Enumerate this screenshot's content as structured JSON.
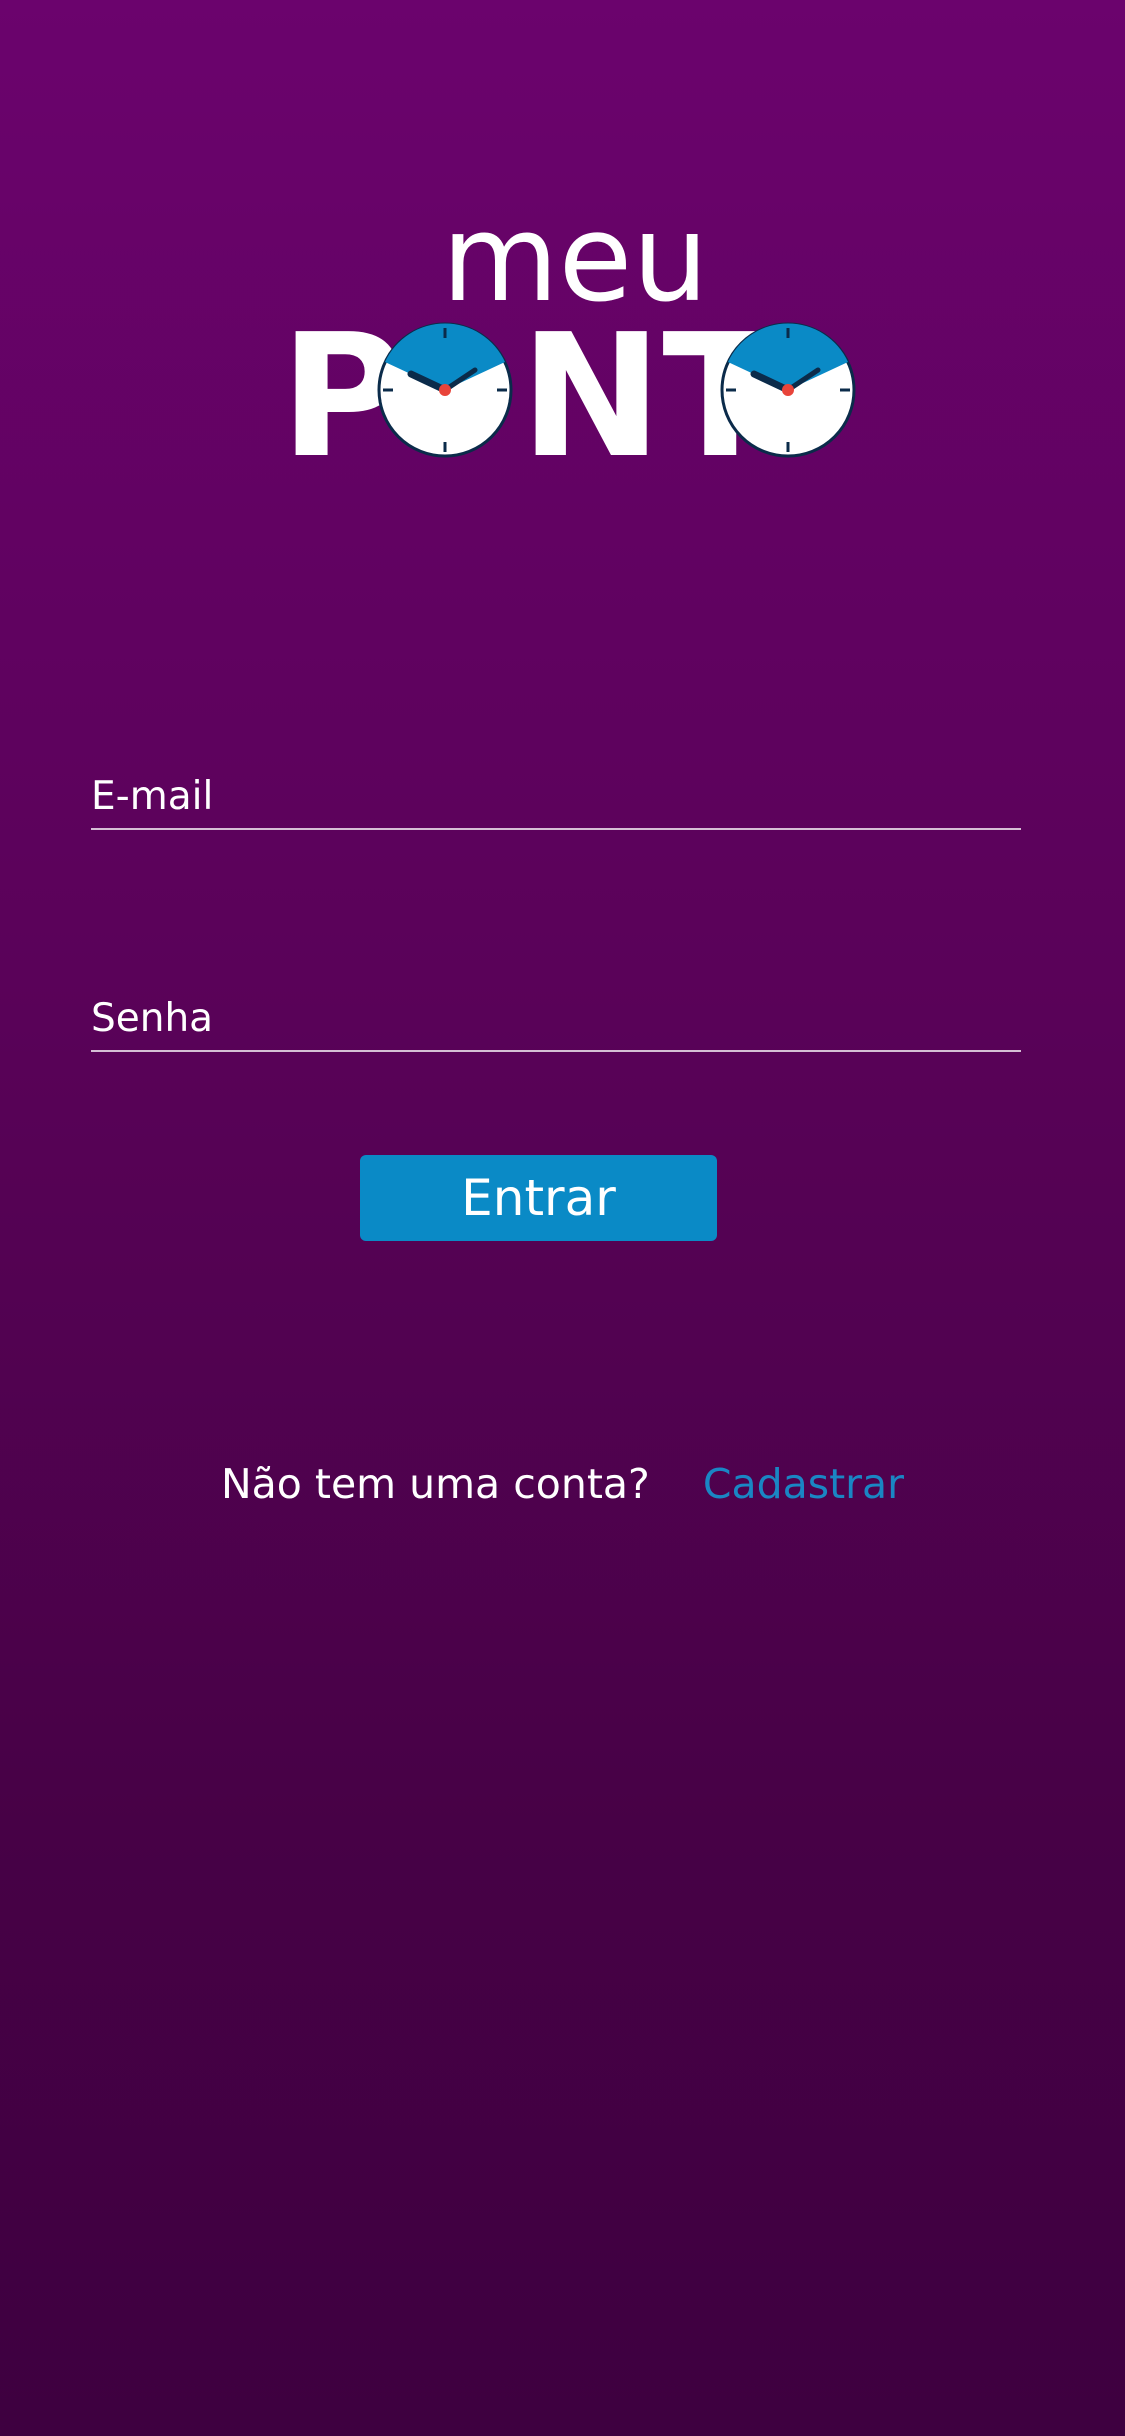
{
  "logo": {
    "line1": "meu",
    "line2_p": "P",
    "line2_nt": "NT",
    "clock_face_color": "#ffffff",
    "clock_accent_color": "#0a8ac6",
    "clock_hand_color": "#0b2b4a",
    "clock_center_color": "#e8443a"
  },
  "login": {
    "email_placeholder": "E-mail",
    "password_placeholder": "Senha",
    "submit_label": "Entrar"
  },
  "signup": {
    "question": "Não tem uma conta?",
    "link_label": "Cadastrar"
  },
  "colors": {
    "background_top": "#6b036d",
    "background_bottom": "#3e0040",
    "accent": "#0a8ac6",
    "link": "#1a86c4"
  }
}
